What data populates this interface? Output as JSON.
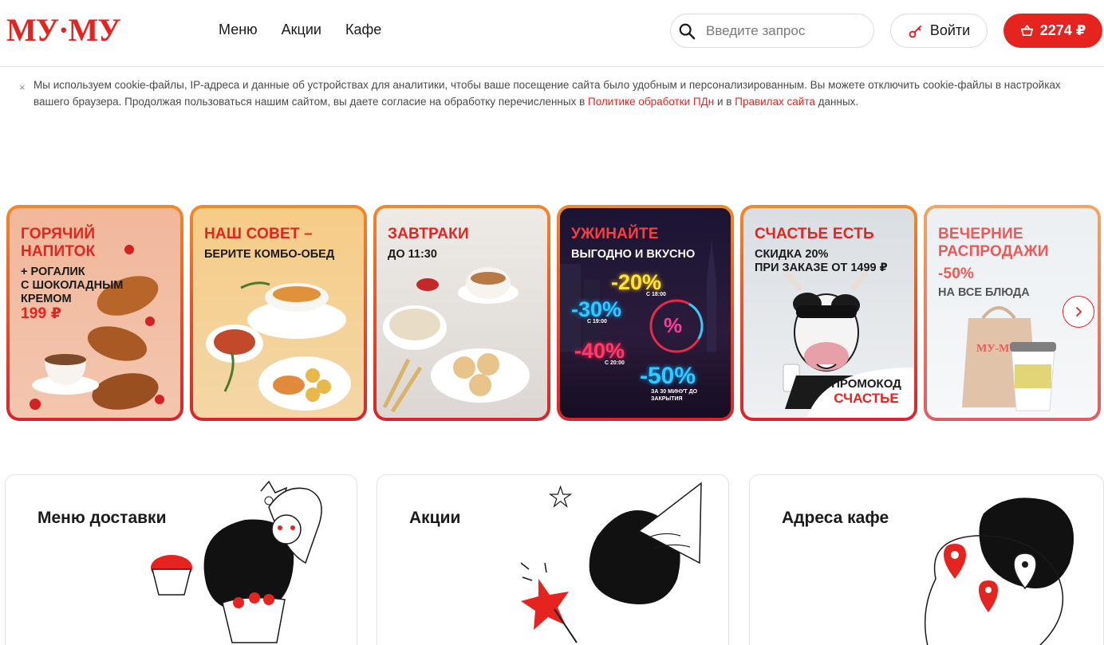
{
  "header": {
    "logo_text": "МУ·МУ",
    "nav": [
      {
        "label": "Меню"
      },
      {
        "label": "Акции"
      },
      {
        "label": "Кафе"
      }
    ],
    "search_placeholder": "Введите запрос",
    "login_label": "Войти",
    "cart_total": "2274 ₽"
  },
  "cookie_notice": {
    "text_before": "Мы используем cookie-файлы, IP-адреса и данные об устройствах для аналитики, чтобы ваше посещение сайта было удобным и персонализированным. Вы можете отключить cookie-файлы в настройках вашего браузера. Продолжая пользоваться нашим сайтом, вы даете согласие на обработку перечисленных в ",
    "link_policy": "Политике обработки ПДн",
    "text_middle": " и в ",
    "link_rules": "Правилах сайта",
    "text_after": " данных.",
    "close": "×"
  },
  "banners": [
    {
      "title_line1": "ГОРЯЧИЙ",
      "title_line2": "НАПИТОК",
      "sub": [
        "+ РОГАЛИК",
        "С ШОКОЛАДНЫМ",
        "КРЕМОМ"
      ],
      "price": "199 ₽"
    },
    {
      "title_line1": "НАШ СОВЕТ –",
      "sub": [
        "БЕРИТЕ КОМБО-ОБЕД"
      ]
    },
    {
      "title_line1": "ЗАВТРАКИ",
      "sub": [
        "ДО 11:30"
      ]
    },
    {
      "title_line1": "УЖИНАЙТЕ",
      "sub": [
        "ВЫГОДНО И ВКУСНО"
      ],
      "neon": [
        {
          "pct": "-20%",
          "note": "С 18:00"
        },
        {
          "pct": "-30%",
          "note": "С 19:00"
        },
        {
          "pct": "-40%",
          "note": "С 20:00"
        },
        {
          "pct": "-50%",
          "note": "ЗА 30 МИНУТ ДО ЗАКРЫТИЯ"
        }
      ]
    },
    {
      "title_line1": "СЧАСТЬЕ ЕСТЬ",
      "sub": [
        "СКИДКА 20%",
        "ПРИ ЗАКАЗЕ ОТ 1499 ₽"
      ],
      "promo_label": "ПРОМОКОД",
      "promo_code": "СЧАСТЬЕ"
    },
    {
      "title_line1": "ВЕЧЕРНИЕ",
      "title_line2": "РАСПРОДАЖИ",
      "discount": "-50%",
      "sub": [
        "НА ВСЕ БЛЮДА"
      ]
    }
  ],
  "categories": [
    {
      "title": "Меню доставки"
    },
    {
      "title": "Акции"
    },
    {
      "title": "Адреса кафе"
    }
  ],
  "colors": {
    "brand_red": "#e52420",
    "banner_border_top": "#f08a2b",
    "banner_border_bottom": "#d9242a"
  }
}
